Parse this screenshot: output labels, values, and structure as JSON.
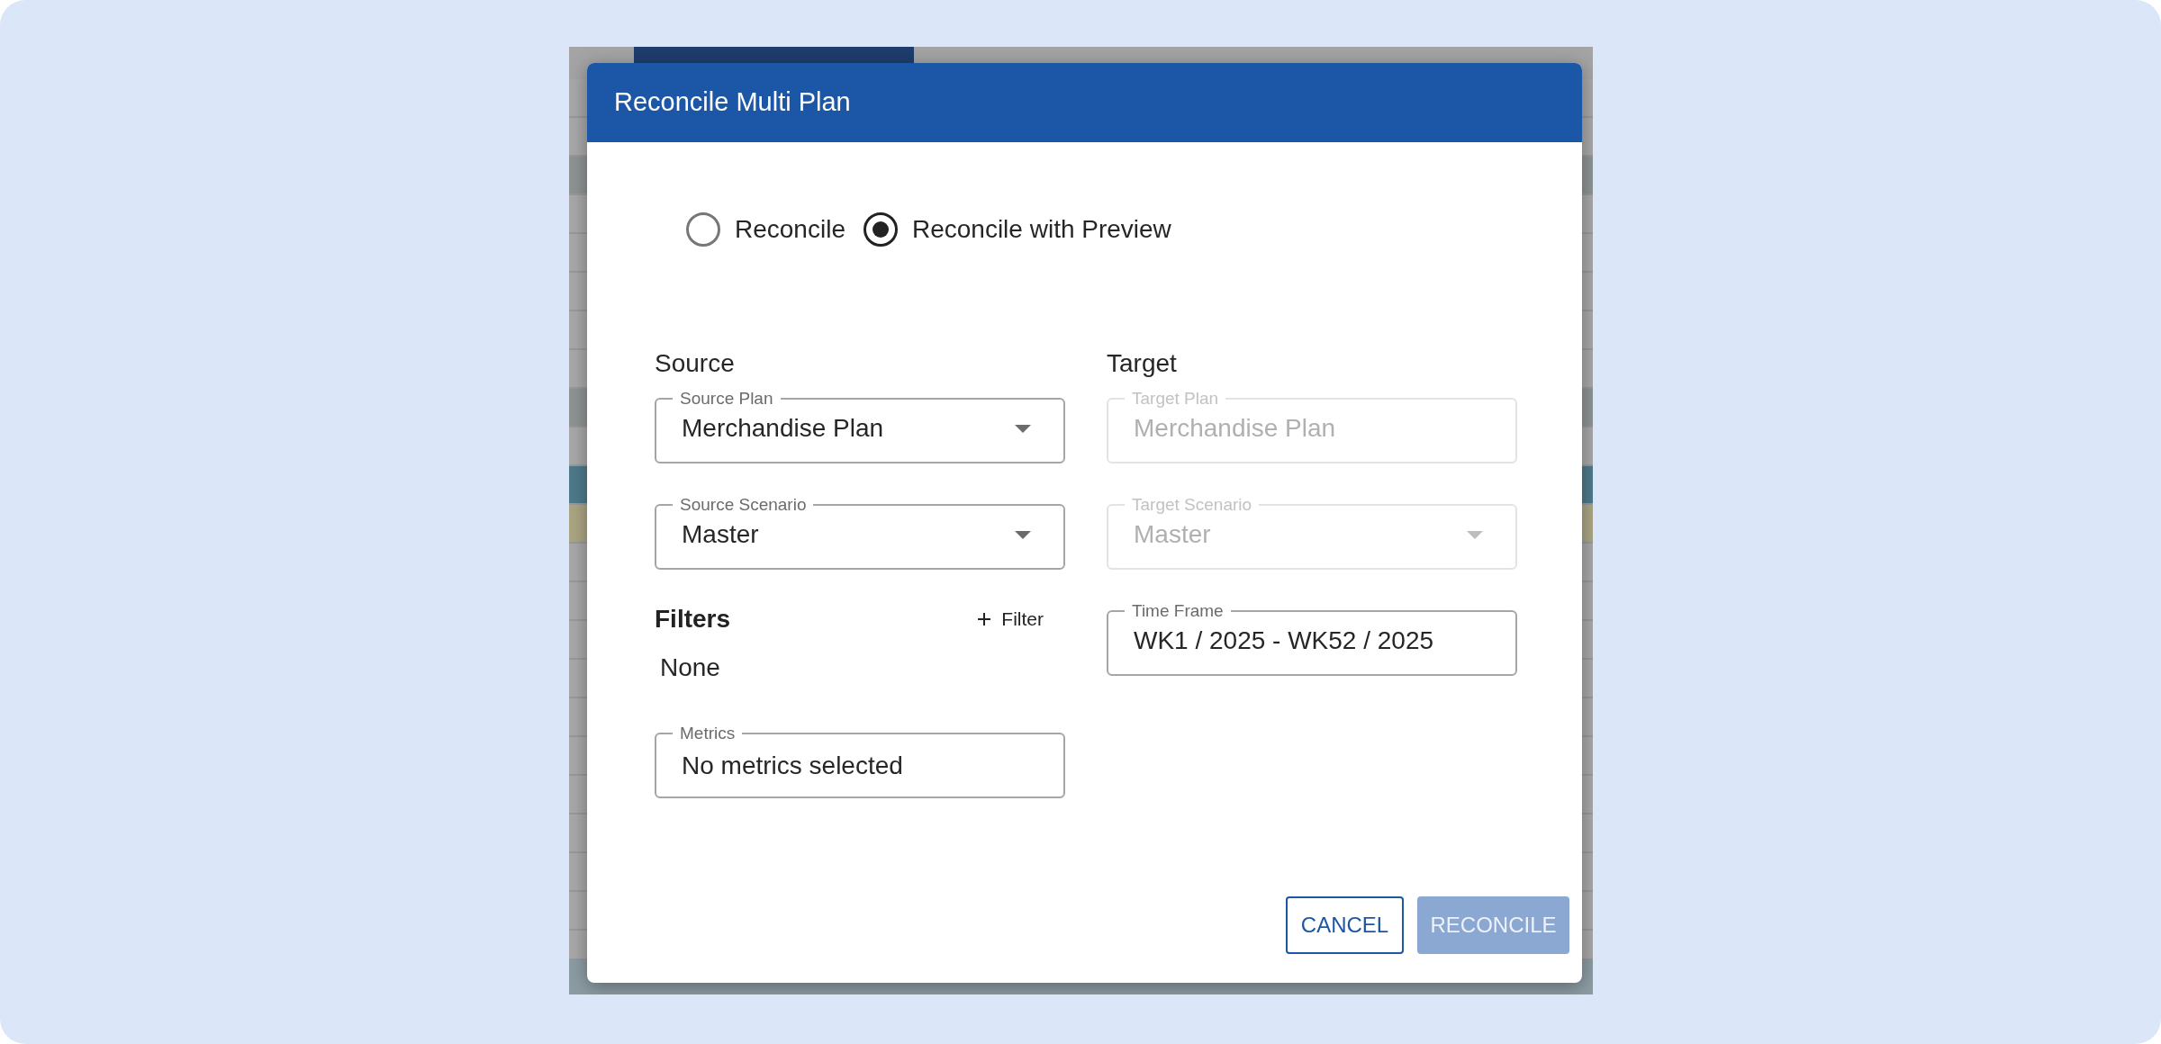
{
  "dialog": {
    "title": "Reconcile Multi Plan",
    "mode_options": [
      {
        "label": "Reconcile",
        "selected": false
      },
      {
        "label": "Reconcile with Preview",
        "selected": true
      }
    ],
    "source": {
      "heading": "Source",
      "fields": [
        {
          "kind": "select",
          "label": "Source Plan",
          "value": "Merchandise Plan",
          "disabled": false
        },
        {
          "kind": "select",
          "label": "Source Scenario",
          "value": "Master",
          "disabled": false
        }
      ]
    },
    "target": {
      "heading": "Target",
      "fields": [
        {
          "kind": "text",
          "label": "Target Plan",
          "value": "Merchandise Plan",
          "disabled": true
        },
        {
          "kind": "select",
          "label": "Target Scenario",
          "value": "Master",
          "disabled": true
        }
      ]
    },
    "filters": {
      "heading": "Filters",
      "add_label": "Filter",
      "value": "None"
    },
    "metrics": {
      "kind": "text",
      "label": "Metrics",
      "value": "No metrics selected",
      "disabled": false
    },
    "time_frame": {
      "kind": "text",
      "label": "Time Frame",
      "value": "WK1 / 2025 - WK52 / 2025",
      "disabled": false
    },
    "buttons": [
      {
        "kind": "outlined",
        "label": "CANCEL",
        "disabled": false
      },
      {
        "kind": "contained",
        "label": "RECONCILE",
        "disabled": true
      }
    ]
  }
}
